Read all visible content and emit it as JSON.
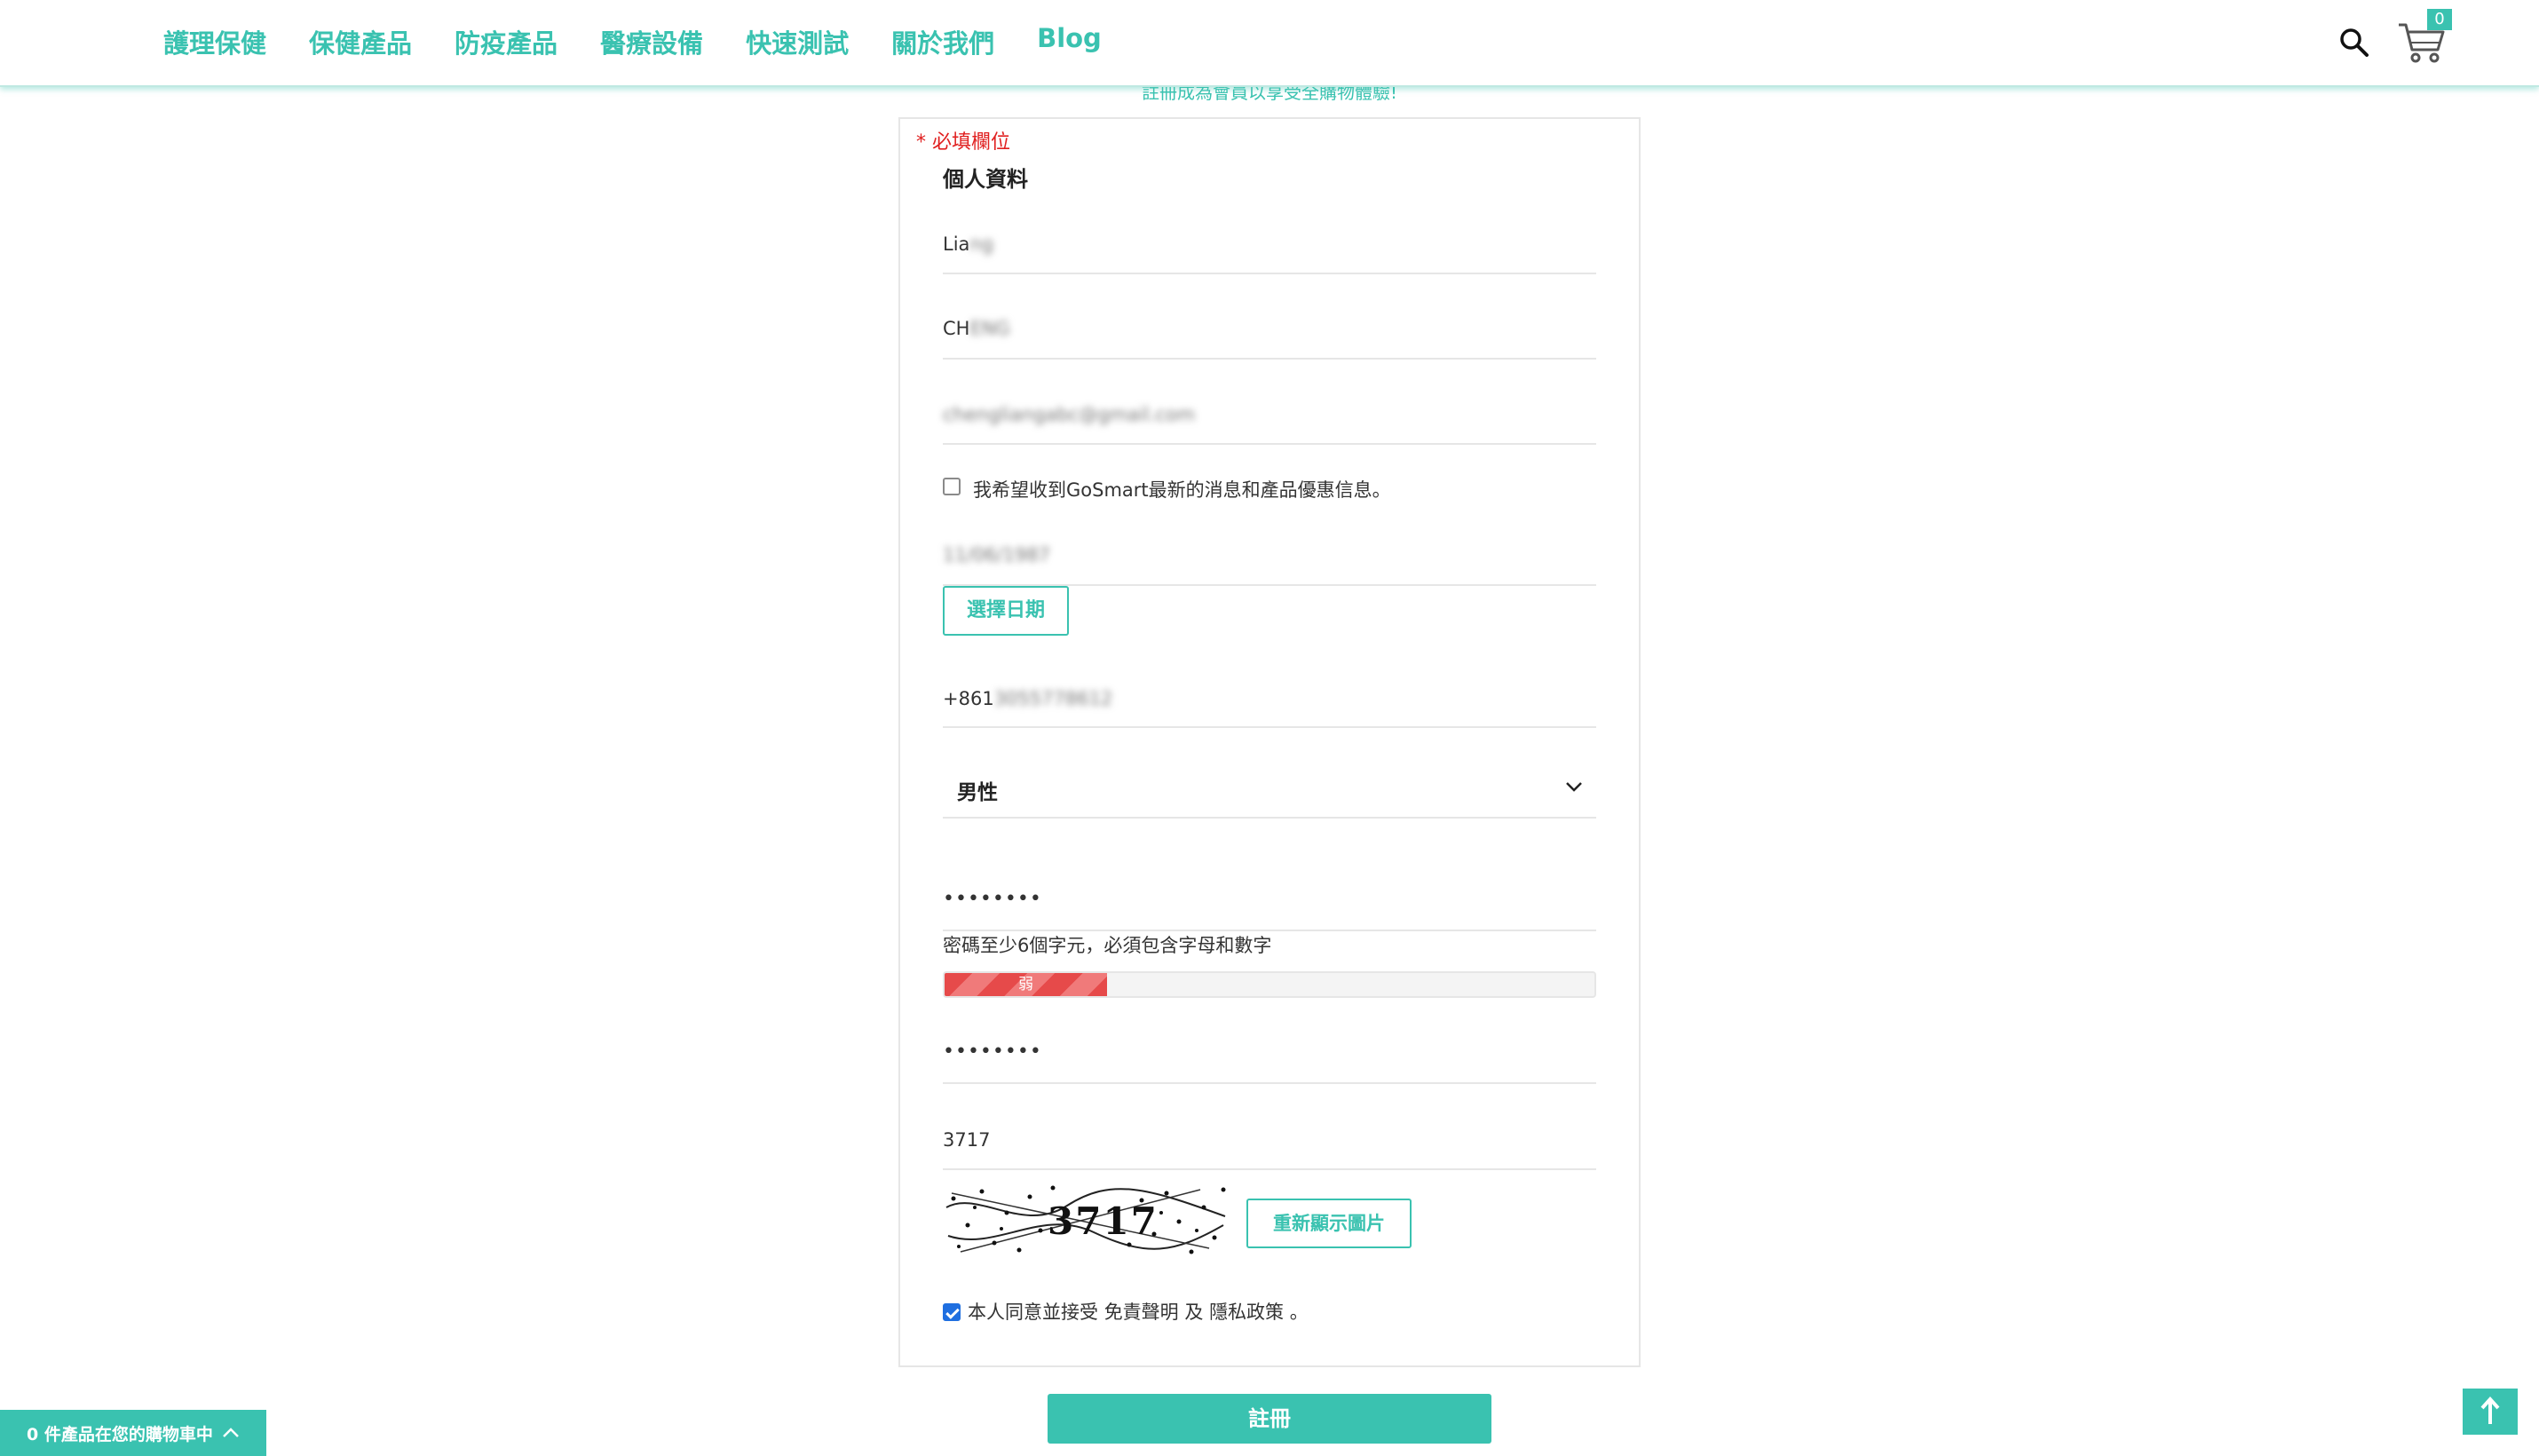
{
  "nav": {
    "items": [
      "護理保健",
      "保健產品",
      "防疫產品",
      "醫療設備",
      "快速測試",
      "關於我們",
      "Blog"
    ],
    "cart_count": "0"
  },
  "form": {
    "subhint": "註冊成為會員以享受全購物體驗!",
    "required_note": "* 必填欄位",
    "section_title": "個人資料",
    "first_name_visible": "Lia",
    "first_name_blurred": "ng",
    "last_name_visible": "CH",
    "last_name_blurred": "ENG",
    "email_blurred": "chengliangabc@gmail.com",
    "newsletter_label": "我希望收到GoSmart最新的消息和產品優惠信息。",
    "birthday_blurred": "11/06/1987",
    "date_button": "選擇日期",
    "phone_visible": "+861",
    "phone_blurred": "3055778612",
    "gender": "男性",
    "password_mask": "••••••••",
    "password_hint": "密碼至少6個字元，必須包含字母和數字",
    "strength_label": "弱",
    "strength_fraction": 0.25,
    "confirm_mask": "••••••••",
    "captcha_value": "3717",
    "captcha_image_text": "3717",
    "refresh_button": "重新顯示圖片",
    "agree_prefix": "本人同意並接受",
    "disclaimer_link": "免責聲明",
    "agree_and": "及",
    "privacy_link": "隱私政策",
    "agree_end": "。",
    "submit": "註冊"
  },
  "cart_bar": {
    "label": "0 件產品在您的購物車中"
  },
  "colors": {
    "accent": "#3ac2b0",
    "required": "#e02020",
    "weak": "#e64a4a",
    "checkbox": "#1f6fe0"
  }
}
